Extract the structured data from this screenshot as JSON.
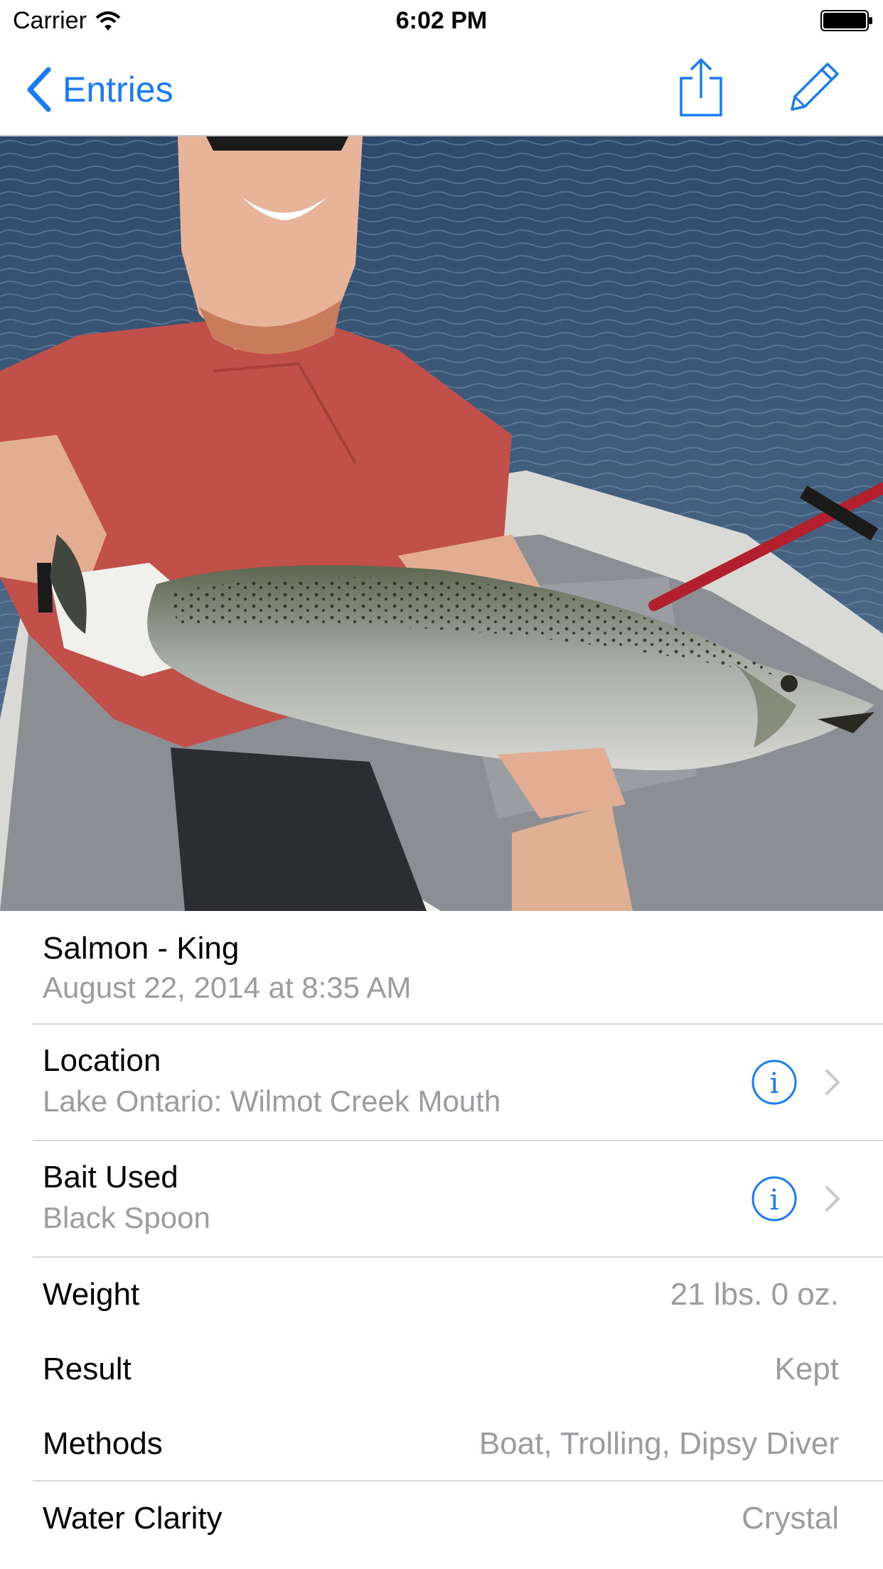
{
  "status_bar": {
    "carrier": "Carrier",
    "time": "6:02 PM"
  },
  "nav": {
    "back_label": "Entries",
    "accent_color": "#1a7cf5"
  },
  "entry": {
    "species": "Salmon - King",
    "date": "August 22, 2014 at 8:35 AM",
    "location": {
      "title": "Location",
      "value": "Lake Ontario: Wilmot Creek Mouth"
    },
    "bait": {
      "title": "Bait Used",
      "value": "Black Spoon"
    },
    "details": [
      {
        "label": "Weight",
        "value": "21 lbs. 0 oz."
      },
      {
        "label": "Result",
        "value": "Kept"
      },
      {
        "label": "Methods",
        "value": "Boat, Trolling, Dipsy Diver"
      },
      {
        "label": "Water Clarity",
        "value": "Crystal"
      }
    ]
  },
  "icons": {
    "share": "share-icon",
    "edit": "pencil-icon",
    "info": "info-circle-icon",
    "disclosure": "chevron-right-icon"
  }
}
